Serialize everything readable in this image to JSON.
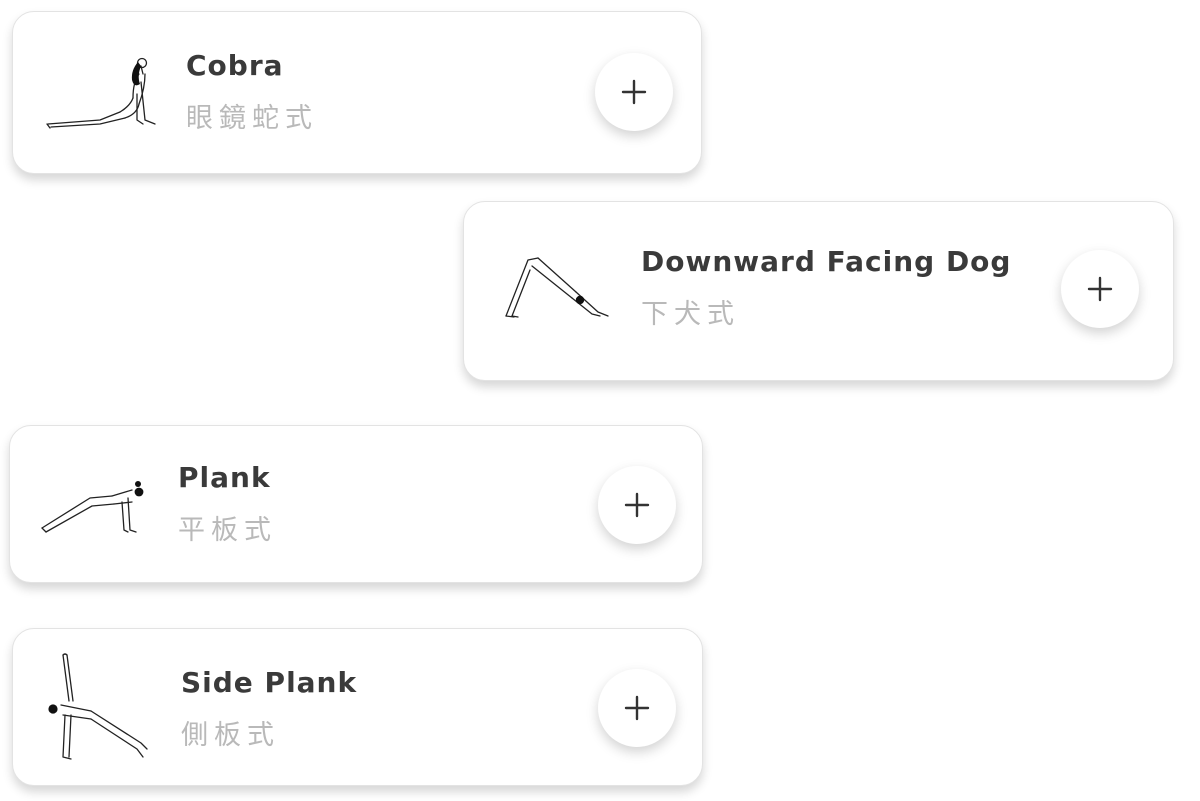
{
  "poses": [
    {
      "key": "cobra",
      "name": "Cobra",
      "name_zh": "眼鏡蛇式",
      "illustration_icon": "cobra-pose-icon",
      "add_icon": "plus-icon"
    },
    {
      "key": "downward-facing-dog",
      "name": "Downward Facing Dog",
      "name_zh": "下犬式",
      "illustration_icon": "downward-dog-pose-icon",
      "add_icon": "plus-icon"
    },
    {
      "key": "plank",
      "name": "Plank",
      "name_zh": "平板式",
      "illustration_icon": "plank-pose-icon",
      "add_icon": "plus-icon"
    },
    {
      "key": "side-plank",
      "name": "Side Plank",
      "name_zh": "側板式",
      "illustration_icon": "side-plank-pose-icon",
      "add_icon": "plus-icon"
    }
  ],
  "colors": {
    "title": "#3a3a3a",
    "subtitle": "#b9b9b9",
    "card_background": "#ffffff",
    "icon_stroke": "#222222"
  }
}
